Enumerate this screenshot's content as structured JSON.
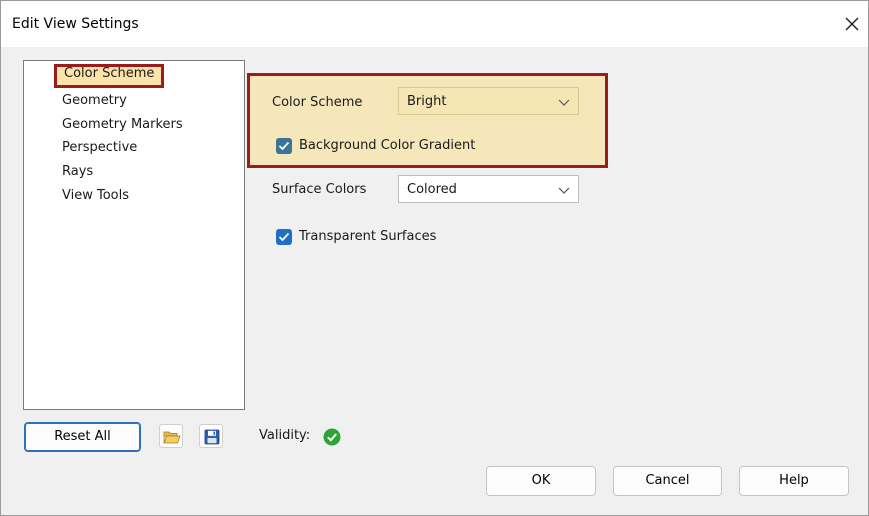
{
  "window": {
    "title": "Edit View Settings"
  },
  "nav": {
    "items": [
      {
        "label": "Color Scheme",
        "selected": true
      },
      {
        "label": "Geometry"
      },
      {
        "label": "Geometry Markers"
      },
      {
        "label": "Perspective"
      },
      {
        "label": "Rays"
      },
      {
        "label": "View Tools"
      }
    ]
  },
  "settings": {
    "color_scheme": {
      "label": "Color Scheme",
      "value": "Bright"
    },
    "background_gradient": {
      "label": "Background Color Gradient",
      "checked": true
    },
    "surface_colors": {
      "label": "Surface Colors",
      "value": "Colored"
    },
    "transparent_surfaces": {
      "label": "Transparent Surfaces",
      "checked": true
    }
  },
  "footer": {
    "reset_label": "Reset All",
    "validity_label": "Validity:",
    "ok_label": "OK",
    "cancel_label": "Cancel",
    "help_label": "Help"
  },
  "icons": {
    "close": "close-icon",
    "open": "folder-open-icon",
    "save": "save-icon",
    "dropdown": "chevron-down-icon",
    "valid": "checkmark-circle-icon",
    "check": "checkmark-icon"
  },
  "colors": {
    "highlight_border": "#9b1b1e",
    "highlight_fill": "#f6e7ba",
    "nav_selected_fill": "#fce3a9",
    "checkbox_blue": "#1f6fc4",
    "valid_green": "#2aa536"
  }
}
